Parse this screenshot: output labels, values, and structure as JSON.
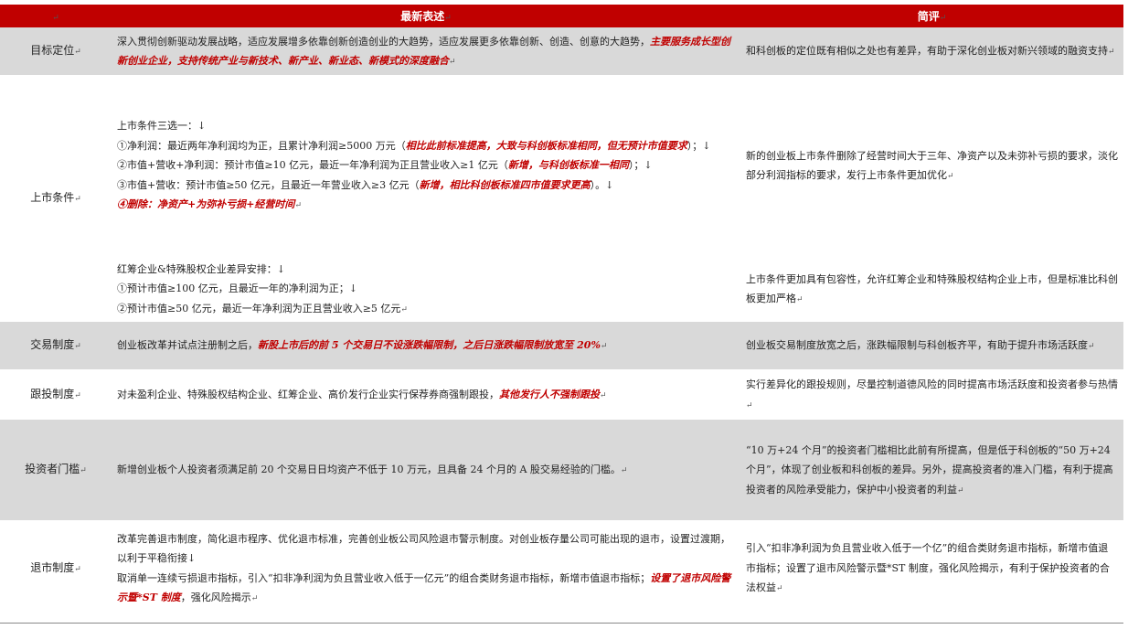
{
  "header": {
    "col0": "",
    "col1": "最新表述",
    "col2": "简评",
    "mark": "↵"
  },
  "rows": [
    {
      "category": "目标定位",
      "desc_lines": [
        {
          "parts": [
            {
              "t": "深入贯彻创新驱动发展战略，适应发展增多依靠创新创造创业的大趋势，适应发展更多依靠创新、创造、创意的大趋势，"
            },
            {
              "t": "主要服务成长型创新创业企业，支持传统产业与新技术、新产业、新业态、新模式的深度融合",
              "em": true
            }
          ]
        }
      ],
      "comment": "和科创板的定位既有相似之处也有差异，有助于深化创业板对新兴领域的融资支持"
    },
    {
      "category": "上市条件",
      "desc_lines": [
        {
          "parts": [
            {
              "t": "上市条件三选一：↓"
            }
          ]
        },
        {
          "parts": [
            {
              "t": "①净利润：最近两年净利润均为正，且累计净利润≥5000 万元（"
            },
            {
              "t": "相比此前标准提高，大致与科创板标准相同，但无预计市值要求",
              "em": true
            },
            {
              "t": "）；↓"
            }
          ]
        },
        {
          "parts": [
            {
              "t": "②市值+营收+净利润：预计市值≥10 亿元，最近一年净利润为正且营业收入≥1 亿元（"
            },
            {
              "t": "新增，与科创板标准一相同",
              "em": true
            },
            {
              "t": "）；↓"
            }
          ]
        },
        {
          "parts": [
            {
              "t": "③市值+营收：预计市值≥50 亿元，且最近一年营业收入≥3 亿元（"
            },
            {
              "t": "新增，相比科创板标准四市值要求更高",
              "em": true
            },
            {
              "t": "）。↓"
            }
          ]
        },
        {
          "parts": [
            {
              "t": "④删除：净资产+为弥补亏损+经营时间",
              "em": true
            }
          ]
        }
      ],
      "comment": "新的创业板上市条件删除了经营时间大于三年、净资产以及未弥补亏损的要求，淡化部分利润指标的要求，发行上市条件更加优化"
    },
    {
      "category": "",
      "desc_lines": [
        {
          "parts": [
            {
              "t": "红筹企业&特殊股权企业差异安排：↓"
            }
          ]
        },
        {
          "parts": [
            {
              "t": "①预计市值≥100 亿元，且最近一年的净利润为正；↓"
            }
          ]
        },
        {
          "parts": [
            {
              "t": "②预计市值≥50 亿元，最近一年净利润为正且营业收入≥5 亿元"
            }
          ]
        }
      ],
      "comment": "上市条件更加具有包容性，允许红筹企业和特殊股权结构企业上市，但是标准比科创板更加严格"
    },
    {
      "category": "交易制度",
      "desc_lines": [
        {
          "parts": [
            {
              "t": "创业板改革并试点注册制之后，"
            },
            {
              "t": "新股上市后的前 5 个交易日不设涨跌幅限制，之后日涨跌幅限制放宽至 20%",
              "em": true
            }
          ]
        }
      ],
      "comment": "创业板交易制度放宽之后，涨跌幅限制与科创板齐平，有助于提升市场活跃度"
    },
    {
      "category": "跟投制度",
      "desc_lines": [
        {
          "parts": [
            {
              "t": "对未盈利企业、特殊股权结构企业、红筹企业、高价发行企业实行保荐券商强制跟投，"
            },
            {
              "t": "其他发行人不强制跟投",
              "em": true
            }
          ]
        }
      ],
      "comment": "实行差异化的跟投规则，尽量控制道德风险的同时提高市场活跃度和投资者参与热情"
    },
    {
      "category": "投资者门槛",
      "desc_lines": [
        {
          "parts": [
            {
              "t": "新增创业板个人投资者须满足前 20 个交易日日均资产不低于 10 万元，且具备 24 个月的 A 股交易经验的门槛。"
            }
          ]
        }
      ],
      "comment": "“10 万+24 个月”的投资者门槛相比此前有所提高，但是低于科创板的“50 万+24 个月”，体现了创业板和科创板的差异。另外，提高投资者的准入门槛，有利于提高投资者的风险承受能力，保护中小投资者的利益"
    },
    {
      "category": "退市制度",
      "desc_lines": [
        {
          "parts": [
            {
              "t": "改革完善退市制度，简化退市程序、优化退市标准，完善创业板公司风险退市警示制度。对创业板存量公司可能出现的退市，设置过渡期，以利于平稳衔接↓"
            }
          ]
        },
        {
          "parts": [
            {
              "t": "取消单一连续亏损退市指标，引入“扣非净利润为负且营业收入低于一亿元”的组合类财务退市指标，新增市值退市指标；"
            },
            {
              "t": "设置了退市风险警示暨*ST 制度",
              "em": true
            },
            {
              "t": "，强化风险揭示"
            }
          ]
        }
      ],
      "comment": "引入“扣非净利润为负且营业收入低于一个亿”的组合类财务退市指标，新增市值退市指标；设置了退市风险警示暨*ST 制度，强化风险揭示，有利于保护投资者的合法权益"
    }
  ]
}
